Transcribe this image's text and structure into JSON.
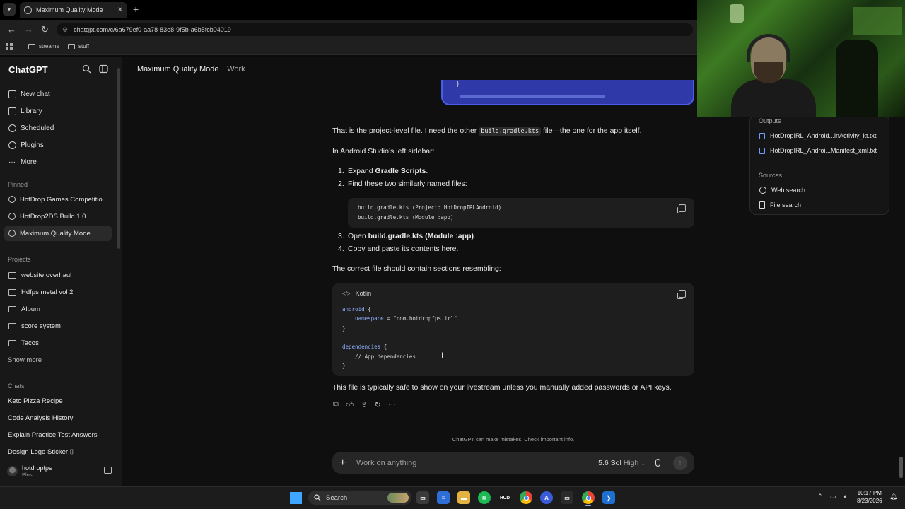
{
  "browser": {
    "tab_title": "Maximum Quality Mode",
    "url": "chatgpt.com/c/6a679ef0-aa78-83e8-9f5b-a6b5fcb04019",
    "bookmarks": [
      "streams",
      "stuff"
    ]
  },
  "sidebar": {
    "brand": "ChatGPT",
    "nav": [
      "New chat",
      "Library",
      "Scheduled",
      "Plugins",
      "More"
    ],
    "pinned_label": "Pinned",
    "pinned": [
      "HotDrop Games Competitio...",
      "HotDrop2DS Build 1.0",
      "Maximum Quality Mode"
    ],
    "projects_label": "Projects",
    "projects": [
      "website overhaul",
      "Hdfps metal vol 2",
      "Album",
      "score system",
      "Tacos"
    ],
    "show_more": "Show more",
    "chats_label": "Chats",
    "chats": [
      "Keto Pizza Recipe",
      "Code Analysis History",
      "Explain Practice Test Answers",
      "Design Logo Sticker ⌷"
    ],
    "user_name": "hotdropfps",
    "user_plan": "Plus"
  },
  "header": {
    "title": "Maximum Quality Mode",
    "separator": "·",
    "mode": "Work"
  },
  "message": {
    "user_bubble_tail": "}",
    "p1_before": "That is the project-level file. I need the other ",
    "p1_code": "build.gradle.kts",
    "p1_after": " file—the one for the app itself.",
    "p2": "In Android Studio’s left sidebar:",
    "steps": [
      {
        "n": "1.",
        "before": "Expand ",
        "bold": "Gradle Scripts",
        "after": "."
      },
      {
        "n": "2.",
        "before": "Find these two similarly named files:",
        "bold": "",
        "after": ""
      },
      {
        "n": "3.",
        "before": "Open ",
        "bold": "build.gradle.kts (Module :app)",
        "after": "."
      },
      {
        "n": "4.",
        "before": "Copy and paste its contents here.",
        "bold": "",
        "after": ""
      }
    ],
    "code1_lines": [
      "build.gradle.kts (Project: HotDropIRLAndroid)",
      "build.gradle.kts (Module :app)"
    ],
    "p3": "The correct file should contain sections resembling:",
    "code2_lang": "Kotlin",
    "code2_lines": [
      {
        "kw": "android",
        "rest": " {"
      },
      {
        "kw": "    namespace",
        "rest": " = \"com.hotdropfps.irl\""
      },
      {
        "kw": "",
        "rest": "}"
      },
      {
        "kw": "",
        "rest": ""
      },
      {
        "kw": "dependencies",
        "rest": " {"
      },
      {
        "kw": "",
        "rest": "    // App dependencies"
      },
      {
        "kw": "",
        "rest": "}"
      }
    ],
    "p4": "This file is typically safe to show on your livestream unless you manually added passwords or API keys."
  },
  "disclaimer": "ChatGPT can make mistakes. Check important info.",
  "composer": {
    "placeholder": "Work on anything",
    "model": "5.6 Sol",
    "effort": "High"
  },
  "right_panel": {
    "outputs_label": "Outputs",
    "outputs": [
      "HotDropIRL_Android...inActivity_kt.txt",
      "HotDropIRL_Androi...Manifest_xml.txt"
    ],
    "sources_label": "Sources",
    "sources": [
      "Web search",
      "File search"
    ]
  },
  "taskbar": {
    "search": "Search",
    "time": "10:17 PM",
    "date": "8/23/2026"
  },
  "colors": {
    "accent_bubble": "#2f3aa8",
    "code_keyword": "#8fb0ff"
  }
}
